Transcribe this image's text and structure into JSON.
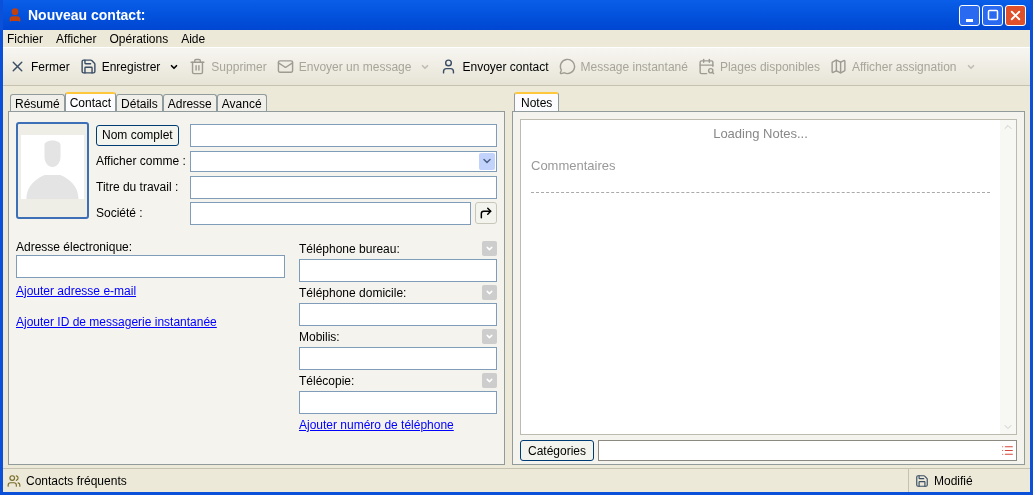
{
  "window": {
    "title": "Nouveau contact:"
  },
  "menu": [
    "Fichier",
    "Afficher",
    "Opérations",
    "Aide"
  ],
  "toolbar": [
    {
      "label": "Fermer",
      "disabled": false,
      "dropdown": false
    },
    {
      "label": "Enregistrer",
      "disabled": false,
      "dropdown": true
    },
    {
      "label": "Supprimer",
      "disabled": true,
      "dropdown": false
    },
    {
      "label": "Envoyer un message",
      "disabled": true,
      "dropdown": true
    },
    {
      "label": "Envoyer contact",
      "disabled": false,
      "dropdown": false
    },
    {
      "label": "Message instantané",
      "disabled": true,
      "dropdown": false
    },
    {
      "label": "Plages disponibles",
      "disabled": true,
      "dropdown": false
    },
    {
      "label": "Afficher assignation",
      "disabled": true,
      "dropdown": true
    }
  ],
  "tabs": [
    {
      "label": "Résumé",
      "selected": false
    },
    {
      "label": "Contact",
      "selected": true
    },
    {
      "label": "Détails",
      "selected": false
    },
    {
      "label": "Adresse",
      "selected": false
    },
    {
      "label": "Avancé",
      "selected": false
    }
  ],
  "name_fields": [
    {
      "kind": "button",
      "label": "Nom complet"
    },
    {
      "kind": "combo",
      "label": "Afficher comme :"
    },
    {
      "kind": "text",
      "label": "Titre du travail :"
    },
    {
      "kind": "action",
      "label": "Société :"
    }
  ],
  "email": {
    "label": "Adresse électronique:",
    "links": [
      "Ajouter adresse e-mail",
      "Ajouter ID de messagerie instantanée"
    ]
  },
  "phones": [
    {
      "label": "Téléphone bureau:"
    },
    {
      "label": "Téléphone domicile:"
    },
    {
      "label": "Mobilis:"
    },
    {
      "label": "Télécopie:"
    }
  ],
  "phone_link": "Ajouter numéro de téléphone",
  "notes": {
    "tab": "Notes",
    "loading": "Loading Notes...",
    "placeholder": "Commentaires",
    "categories_button": "Catégories"
  },
  "status_bar": {
    "left": "Contacts fréquents",
    "right": "Modifié"
  }
}
